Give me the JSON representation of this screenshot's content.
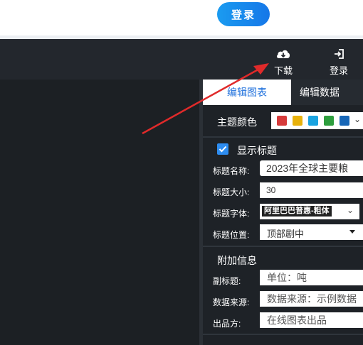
{
  "header": {
    "login_button": "登录"
  },
  "toolbar": {
    "download_label": "下载",
    "login_label": "登录"
  },
  "panel": {
    "tabs": [
      "编辑图表",
      "编辑数据"
    ],
    "theme_color_label": "主题颜色",
    "theme_colors": [
      "#d63b3b",
      "#e8b20c",
      "#1aa3e0",
      "#2e9e3e",
      "#1767b8"
    ],
    "show_title_label": "显示标题",
    "show_title_checked": true,
    "title_name_label": "标题名称:",
    "title_name_value": "2023年全球主要粮",
    "title_size_label": "标题大小:",
    "title_size_value": "30",
    "title_font_label": "标题字体:",
    "title_font_value": "阿里巴巴普惠-粗体",
    "title_position_label": "标题位置:",
    "title_position_value": "顶部剧中",
    "extra_info_header": "附加信息",
    "subtitle_label": "副标题:",
    "subtitle_value": "单位：吨",
    "source_label": "数据来源:",
    "source_value": "数据来源：示例数据",
    "producer_label": "出品方:",
    "producer_value": "在线图表出品"
  }
}
